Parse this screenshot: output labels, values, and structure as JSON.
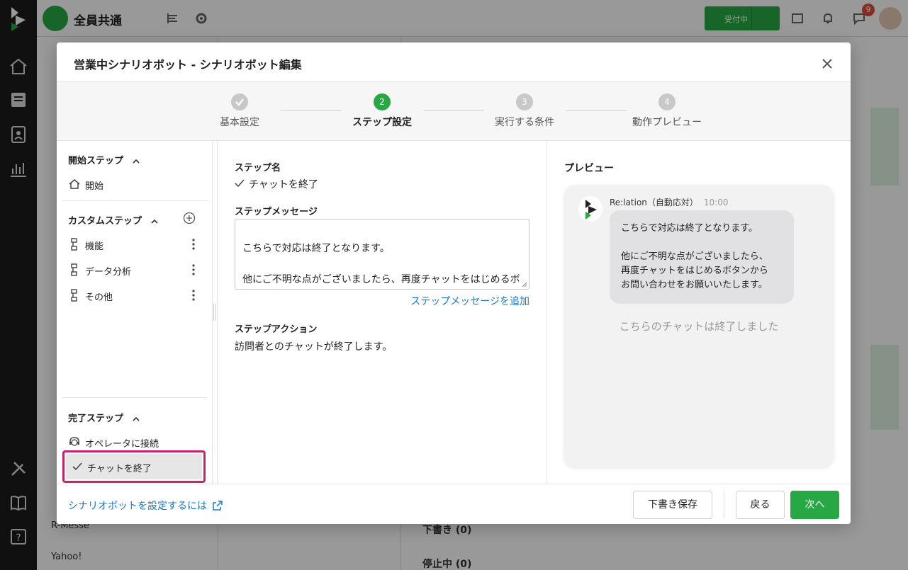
{
  "topbar": {
    "title": "全員共通",
    "status_label": "受付中",
    "notif_count": "9"
  },
  "background_sidebar": {
    "items": [
      "R-Messe",
      "Yahoo!"
    ]
  },
  "background_folds": {
    "draft": "下書き (0)",
    "stopped": "停止中 (0)"
  },
  "modal": {
    "title": "営業中シナリオボット - シナリオボット編集",
    "steps": [
      {
        "num": "",
        "label": "基本設定"
      },
      {
        "num": "2",
        "label": "ステップ設定"
      },
      {
        "num": "3",
        "label": "実行する条件"
      },
      {
        "num": "4",
        "label": "動作プレビュー"
      }
    ],
    "left": {
      "start_header": "開始ステップ",
      "start_item": "開始",
      "custom_header": "カスタムステップ",
      "custom_items": [
        "機能",
        "データ分析",
        "その他"
      ],
      "end_header": "完了ステップ",
      "end_items": [
        "オペレータに接続",
        "チャットを終了"
      ]
    },
    "form": {
      "step_name_label": "ステップ名",
      "step_name_value": "チャットを終了",
      "message_label": "ステップメッセージ",
      "message_value": "こちらで対応は終了となります。\n\n他にご不明な点がございましたら、再度チャットをはじめるボタンからお問い合わせをお願いいたします。",
      "add_message_link": "ステップメッセージを追加",
      "action_label": "ステップアクション",
      "action_value": "訪問者とのチャットが終了します。"
    },
    "preview": {
      "title": "プレビュー",
      "sender": "Re:lation（自動応対）",
      "time": "10:00",
      "bubble": "こちらで対応は終了となります。\n\n他にご不明な点がございましたら、\n再度チャットをはじめるボタンから\nお問い合わせをお願いいたします。",
      "ended_text": "こちらのチャットは終了しました"
    },
    "footer": {
      "help_link": "シナリオボットを設定するには",
      "save_draft": "下書き保存",
      "back": "戻る",
      "next": "次へ"
    }
  },
  "colors": {
    "brand_green": "#27a844",
    "link_blue": "#1a79c9",
    "selected_outline": "#c8246b"
  }
}
